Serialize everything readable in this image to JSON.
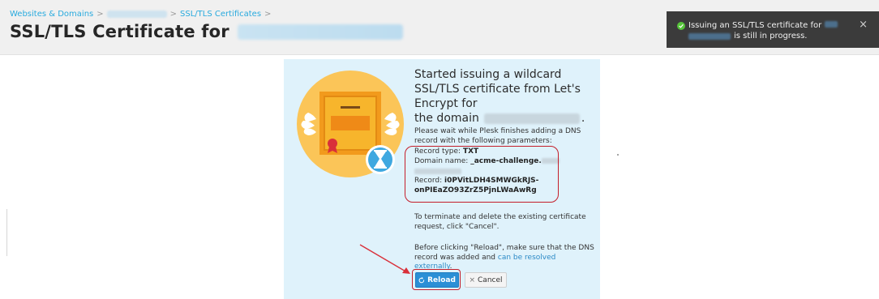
{
  "header": {
    "breadcrumb": {
      "item1": "Websites & Domains",
      "sep1": ">",
      "sep2": ">",
      "item3": "SSL/TLS Certificates",
      "sep3": ">"
    },
    "title_prefix": "SSL/TLS Certificate for"
  },
  "toast": {
    "line1": "Issuing an SSL/TLS certificate for",
    "line2_suffix": "is still in progress.",
    "close_icon": "×",
    "status_color": "#56c43a"
  },
  "panel": {
    "heading_line": "Started issuing a wildcard SSL/TLS certificate from Let's Encrypt for",
    "heading_domain_prefix": "the domain",
    "heading_domain_suffix": ".",
    "wait_text": "Please wait while Plesk finishes adding a DNS record with the following parameters:",
    "record_type_label": "Record type:",
    "record_type_value": "TXT",
    "domain_name_label": "Domain name:",
    "domain_name_value": "_acme-challenge.",
    "record_label": "Record:",
    "record_value_1": "i0PVitLDH4SMWGkRJS-",
    "record_value_2": "onPIEaZO93ZrZ5PjnLWaAwRg",
    "terminate_text": "To terminate and delete the existing certificate request, click \"Cancel\".",
    "before_text": "Before clicking \"Reload\", make sure that the DNS record was added and",
    "before_link": "can be resolved externally",
    "before_end": "."
  },
  "buttons": {
    "reload_label": "Reload",
    "reload_icon": "refresh-icon",
    "cancel_label": "Cancel",
    "cancel_icon": "×"
  },
  "colors": {
    "accent": "#2b8fd6",
    "annotation": "#c41e2a",
    "panel_bg": "#dff2fb"
  }
}
